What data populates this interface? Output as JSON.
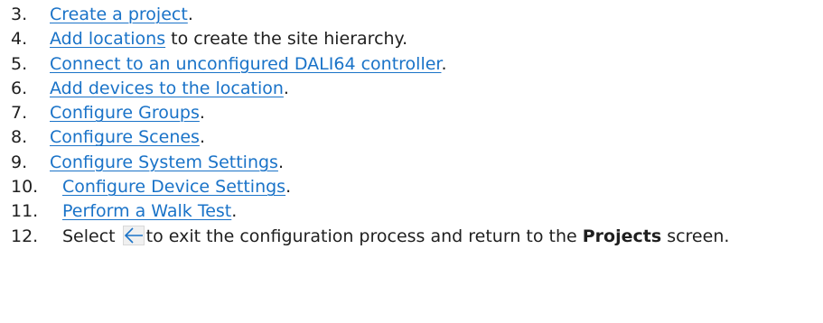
{
  "steps": [
    {
      "number": "3.",
      "link": "Create a project",
      "after": "."
    },
    {
      "number": "4.",
      "link": "Add locations",
      "after": " to create the site hierarchy."
    },
    {
      "number": "5.",
      "link": "Connect to an unconfigured DALI64 controller",
      "after": "."
    },
    {
      "number": "6.",
      "link": "Add devices to the location",
      "after": "."
    },
    {
      "number": "7.",
      "link": "Configure Groups",
      "after": "."
    },
    {
      "number": "8.",
      "link": "Configure Scenes",
      "after": "."
    },
    {
      "number": "9.",
      "link": "Configure System Settings",
      "after": "."
    },
    {
      "number": "10.",
      "link": "Configure Device Settings",
      "after": "."
    },
    {
      "number": "11.",
      "link": "Perform a Walk Test",
      "after": "."
    },
    {
      "number": "12.",
      "before": "Select ",
      "icon": "back-arrow-icon",
      "after": "to exit the configuration process and return to the ",
      "bold": "Projects",
      "end": " screen."
    }
  ],
  "colors": {
    "link": "#1a73c8",
    "text": "#1f1f1f",
    "icon_bg": "#f0f0f0"
  }
}
